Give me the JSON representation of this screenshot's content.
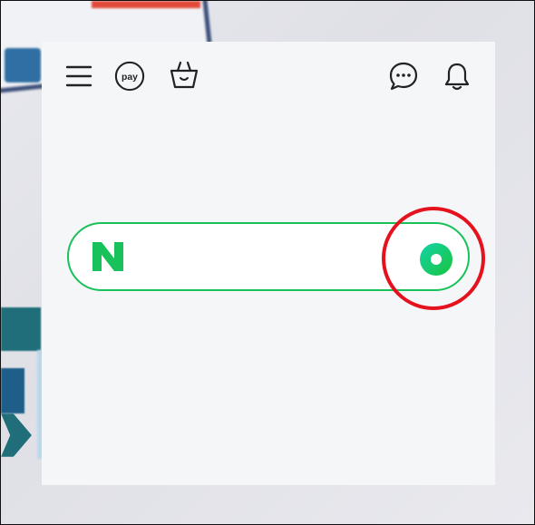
{
  "header": {
    "menu_icon": "hamburger-icon",
    "pay_label": "pay",
    "cart_icon": "shopping-bag-icon",
    "chat_icon": "chat-bubble-icon",
    "bell_icon": "bell-icon"
  },
  "search": {
    "logo_letter": "N",
    "placeholder": "",
    "value": "",
    "voice_icon": "green-circle-search-icon"
  },
  "annotation": {
    "highlight_color": "#e5121e"
  },
  "colors": {
    "naver_green": "#19c15a",
    "panel_bg": "#f5f6f8"
  }
}
